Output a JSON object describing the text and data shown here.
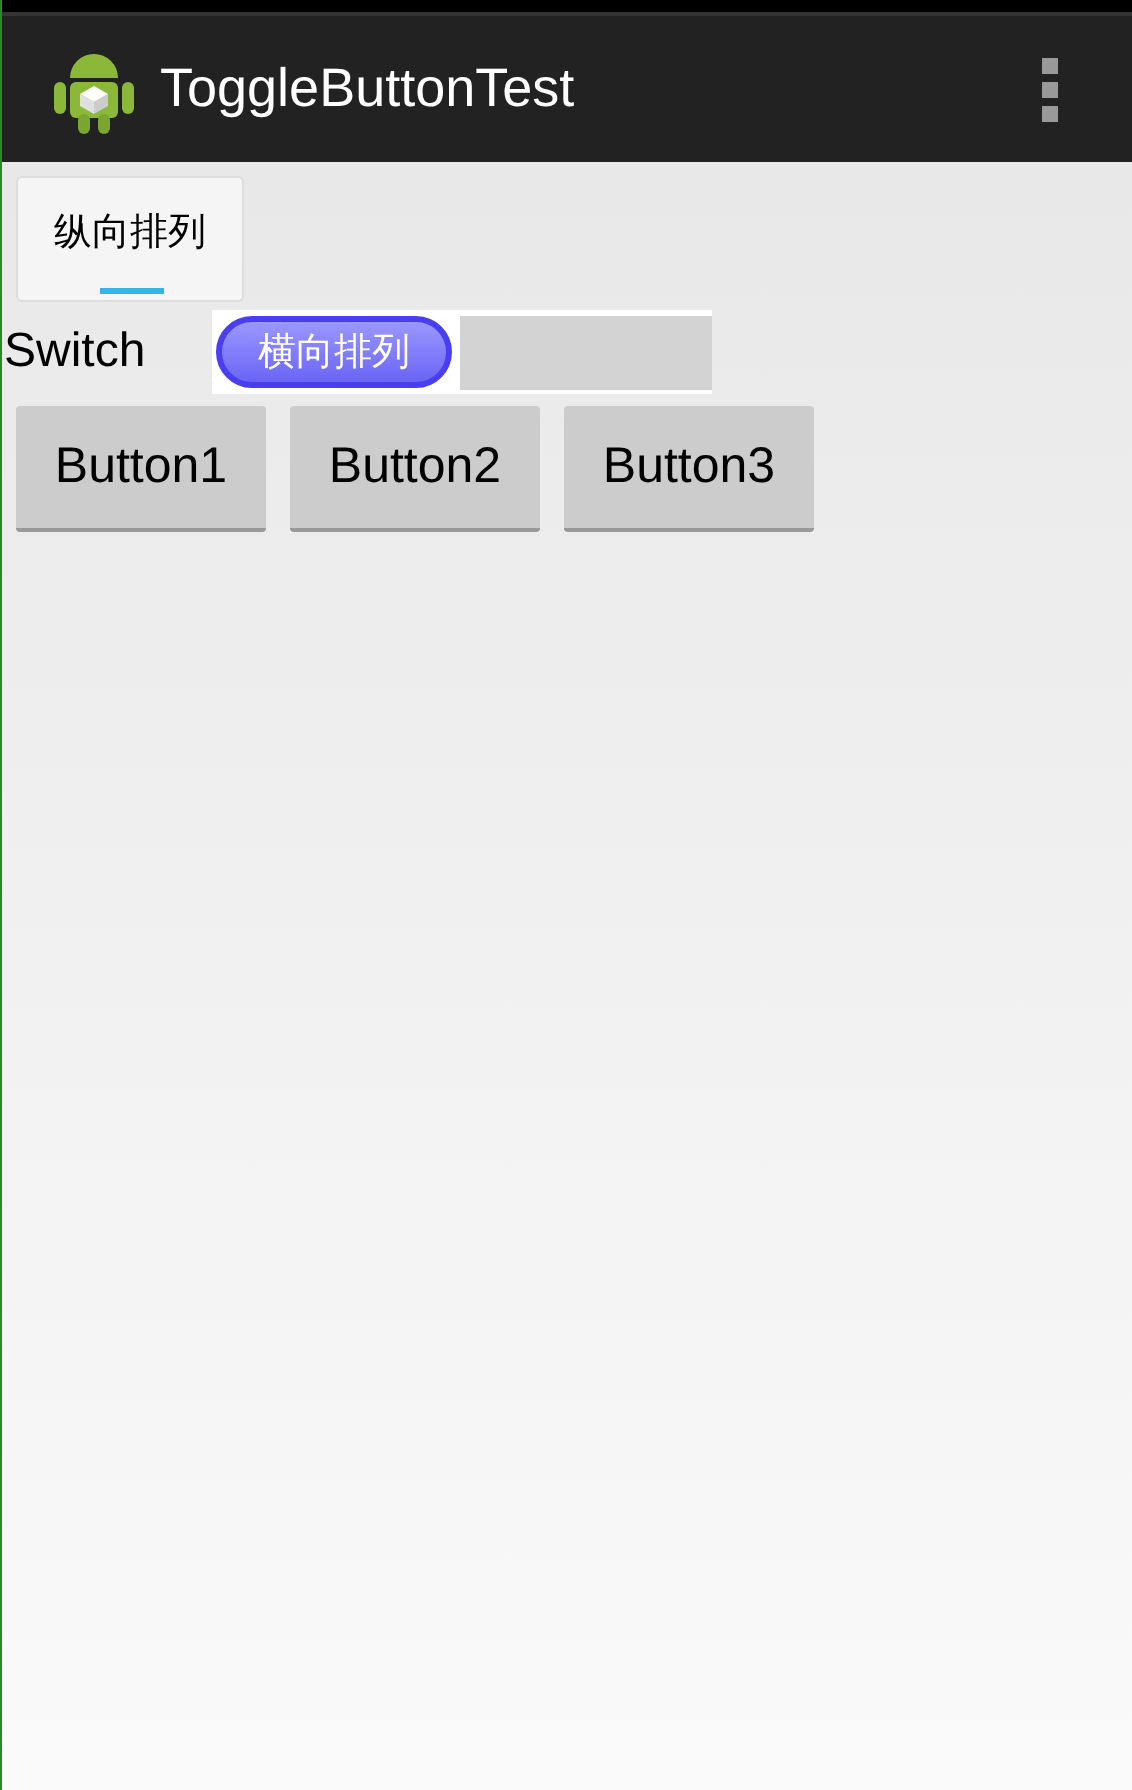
{
  "app_bar": {
    "title": "ToggleButtonTest"
  },
  "toggle_button": {
    "label": "纵向排列",
    "checked": true
  },
  "switch": {
    "label": "Switch",
    "thumb_text": "横向排列",
    "checked": false
  },
  "buttons": [
    "Button1",
    "Button2",
    "Button3"
  ]
}
